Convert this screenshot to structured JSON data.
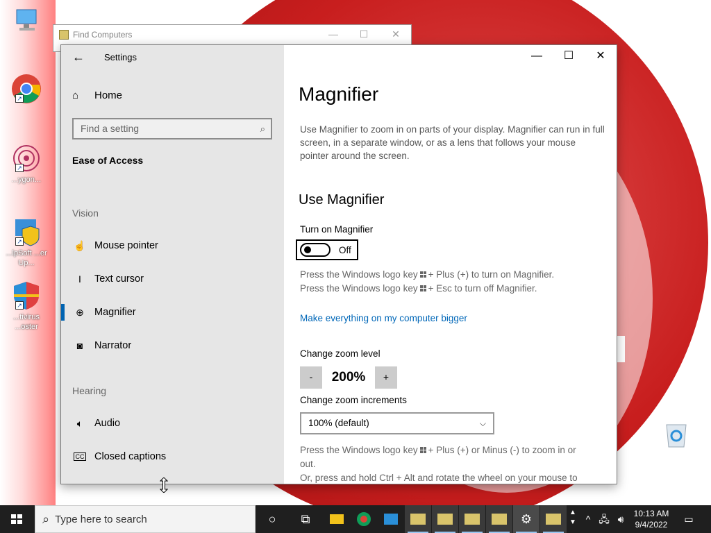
{
  "desktop": {
    "icons": [
      {
        "name": "this-pc",
        "label": ""
      },
      {
        "name": "chrome",
        "label": ""
      },
      {
        "name": "polygon-app",
        "label": "...ygon..."
      },
      {
        "name": "helpsoft-updater",
        "label": "...lpSoft ...er Up..."
      },
      {
        "name": "antivirus-booster",
        "label": "...tivirus ...oster"
      }
    ]
  },
  "find_window": {
    "title": "Find Computers"
  },
  "settings": {
    "window_title": "Settings",
    "nav": {
      "home": "Home",
      "search_placeholder": "Find a setting",
      "group": "Ease of Access",
      "section_vision": "Vision",
      "section_hearing": "Hearing",
      "items": [
        {
          "label": "Mouse pointer",
          "icon": "mouse-pointer-icon"
        },
        {
          "label": "Text cursor",
          "icon": "text-cursor-icon"
        },
        {
          "label": "Magnifier",
          "icon": "magnifier-icon",
          "selected": true
        },
        {
          "label": "Narrator",
          "icon": "narrator-icon"
        },
        {
          "label": "Audio",
          "icon": "audio-icon"
        },
        {
          "label": "Closed captions",
          "icon": "closed-captions-icon"
        }
      ]
    },
    "content": {
      "title": "Magnifier",
      "description": "Use Magnifier to zoom in on parts of your display. Magnifier can run in full screen, in a separate window, or as a lens that follows your mouse pointer around the screen.",
      "section_title": "Use Magnifier",
      "toggle_label": "Turn on Magnifier",
      "toggle_state": "Off",
      "hint_on_pre": "Press the Windows logo key",
      "hint_on_post": "+ Plus (+) to turn on Magnifier.",
      "hint_off_pre": "Press the Windows logo key",
      "hint_off_post": "+ Esc to turn off Magnifier.",
      "link": "Make everything on my computer bigger",
      "zoom_label": "Change zoom level",
      "zoom_minus": "-",
      "zoom_value": "200%",
      "zoom_plus": "+",
      "increments_label": "Change zoom increments",
      "increments_value": "100% (default)",
      "zoom_hint_pre": "Press the Windows logo key",
      "zoom_hint_post": "+ Plus (+) or Minus (-) to zoom in or",
      "zoom_hint_line2": "out.",
      "zoom_hint_line3": "Or, press and hold Ctrl + Alt and rotate the wheel on your mouse to"
    }
  },
  "taskbar": {
    "search_placeholder": "Type here to search",
    "time": "10:13 AM",
    "date": "9/4/2022"
  },
  "colors": {
    "accent": "#0063b1",
    "link": "#0067b8",
    "taskbar": "#1f1f1f",
    "nav_bg": "#e6e6e6"
  }
}
